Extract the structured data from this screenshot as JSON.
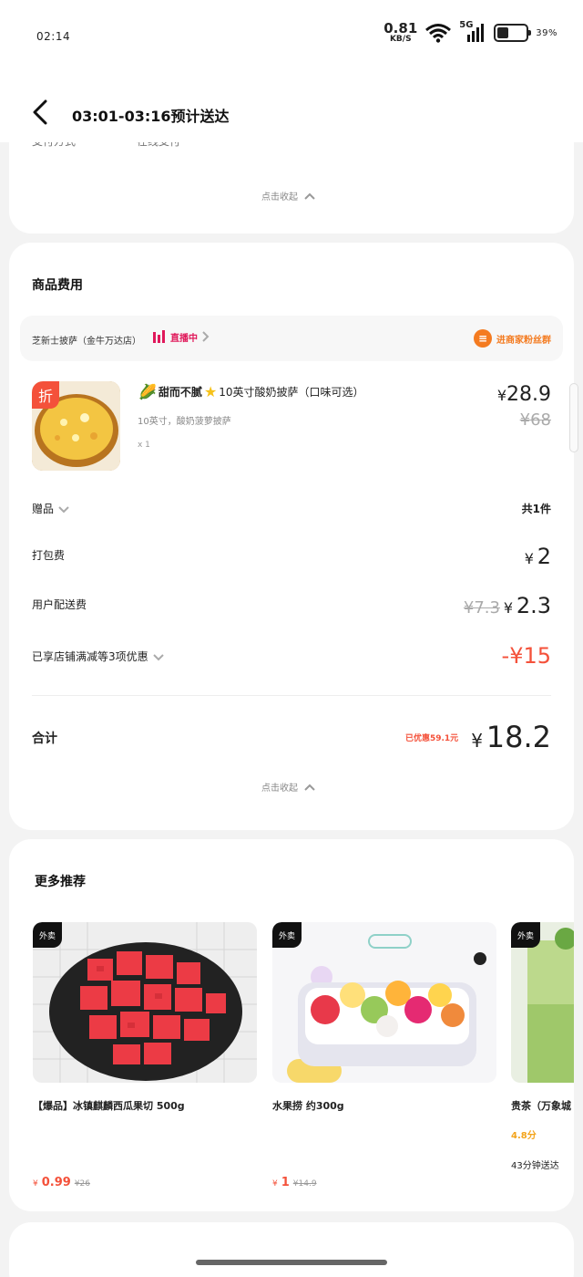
{
  "status": {
    "time": "02:14",
    "speed_value": "0.81",
    "speed_unit": "KB/S",
    "network": "5G",
    "battery_level": 0.39,
    "battery_pct": "39%"
  },
  "nav": {
    "title": "03:01-03:16预计送达",
    "cut_left": "支付方式",
    "cut_right": "在线支付"
  },
  "order_info": {
    "collapse_label": "点击收起"
  },
  "goods": {
    "section_title": "商品费用",
    "store": {
      "name": "芝新士披萨（金牛万达店）",
      "live_label": "直播中",
      "fans_label": "进商家粉丝群"
    },
    "product": {
      "discount_tag": "折",
      "title_a": "甜而不腻",
      "title_b": "10英寸酸奶披萨（口味可选）",
      "spec": "10英寸，酸奶菠萝披萨",
      "qty": "x 1",
      "currency": "¥",
      "price": "28.9",
      "original_price": "¥68"
    },
    "gift": {
      "label": "赠品",
      "value": "共1件"
    },
    "packing": {
      "label": "打包费",
      "currency": "¥",
      "value": "2"
    },
    "delivery": {
      "label": "用户配送费",
      "original": "¥7.3",
      "currency": "¥",
      "value": "2.3"
    },
    "discounts": {
      "label": "已享店铺满减等3项优惠",
      "value": "-¥15"
    },
    "total": {
      "label": "合计",
      "saved": "已优惠59.1元",
      "currency": "¥",
      "value": "18.2"
    },
    "collapse_label": "点击收起"
  },
  "recommend": {
    "title": "更多推荐",
    "items": [
      {
        "tag": "外卖",
        "name": "【爆品】冰镇麒麟西瓜果切 500g",
        "currency": "¥",
        "price": "0.99",
        "original": "¥26"
      },
      {
        "tag": "外卖",
        "name": "水果捞 约300g",
        "currency": "¥",
        "price": "1",
        "original": "¥14.9"
      },
      {
        "tag": "外卖",
        "name": "贵茶（万象城",
        "rating": "4.8分",
        "time": "43分钟送达"
      }
    ]
  }
}
